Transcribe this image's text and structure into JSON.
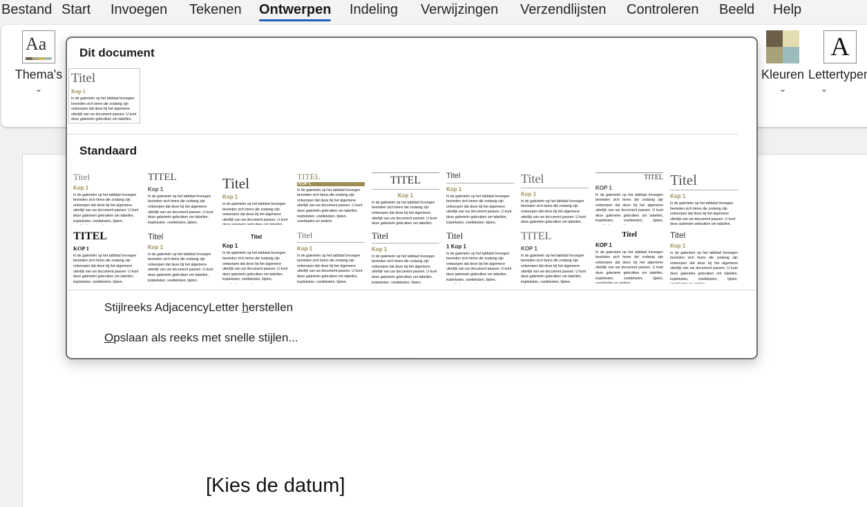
{
  "menu": {
    "tabs": [
      "Bestand",
      "Start",
      "Invoegen",
      "Tekenen",
      "Ontwerpen",
      "Indeling",
      "Verwijzingen",
      "Verzendlijsten",
      "Controleren",
      "Beeld",
      "Help"
    ],
    "active": "Ontwerpen"
  },
  "ribbon": {
    "themes_label": "Thema's",
    "themes_icon_text": "Aa",
    "colors_label": "Kleuren",
    "fonts_label": "Lettertypen",
    "fonts_icon_text": "A",
    "swatch_colors": [
      "#6b5f4a",
      "#e4ddb0",
      "#a8a27a",
      "#9bbcbc"
    ]
  },
  "panel": {
    "this_document_heading": "Dit document",
    "standard_heading": "Standaard",
    "reset_item": "Stijlreeks AdjacencyLetter herstellen",
    "save_item": "Opslaan als reeks met snelle stijlen..."
  },
  "sample": {
    "title": "Titel",
    "title_upper": "TITEL",
    "heading": "Kop 1",
    "heading_upper": "KOP 1",
    "heading_numbered": "1   Kop 1",
    "body": "In de galerieën op het tabblad Invoegen bevinden zich items die zodanig zijn ontworpen dat deze bij het algemene uiterlijk van uw document passen. U kunt deze galerieën gebruiken om tabellen, kopteksten, voetteksten, lijsten, voorbladen en andere"
  },
  "document": {
    "date_placeholder": "[Kies de datum]"
  }
}
